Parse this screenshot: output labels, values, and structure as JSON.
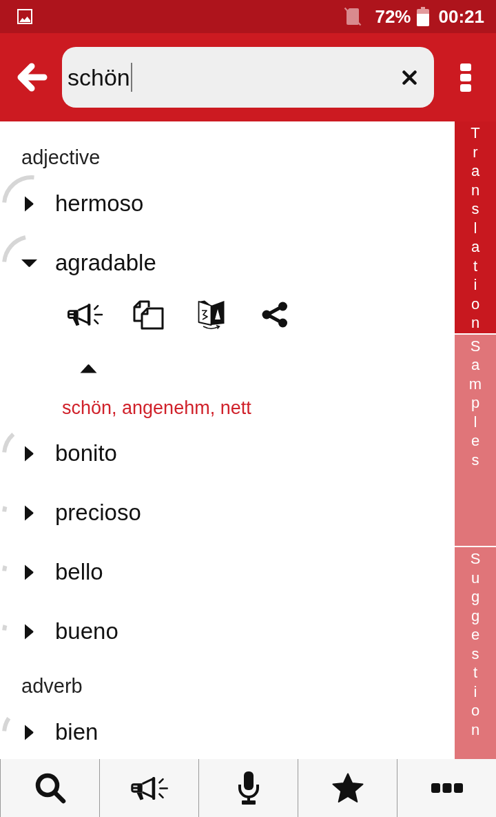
{
  "status_bar": {
    "battery": "72%",
    "time": "00:21"
  },
  "search": {
    "value": "schön"
  },
  "sections": [
    {
      "heading": "adjective",
      "entries": [
        {
          "word": "hermoso",
          "level": 0.25,
          "expanded": false
        },
        {
          "word": "agradable",
          "level": 0.2,
          "expanded": true,
          "translation": "schön, angenehm, nett"
        },
        {
          "word": "bonito",
          "level": 0.12,
          "expanded": false
        },
        {
          "word": "precioso",
          "level": 0.03,
          "expanded": false
        },
        {
          "word": "bello",
          "level": 0.03,
          "expanded": false
        },
        {
          "word": "bueno",
          "level": 0.03,
          "expanded": false
        }
      ]
    },
    {
      "heading": "adverb",
      "entries": [
        {
          "word": "bien",
          "level": 0.08,
          "expanded": false
        }
      ]
    }
  ],
  "side_tabs": [
    {
      "label": "Translation",
      "selected": true
    },
    {
      "label": "Samples",
      "selected": false
    },
    {
      "label": "Suggestion",
      "selected": false
    }
  ]
}
